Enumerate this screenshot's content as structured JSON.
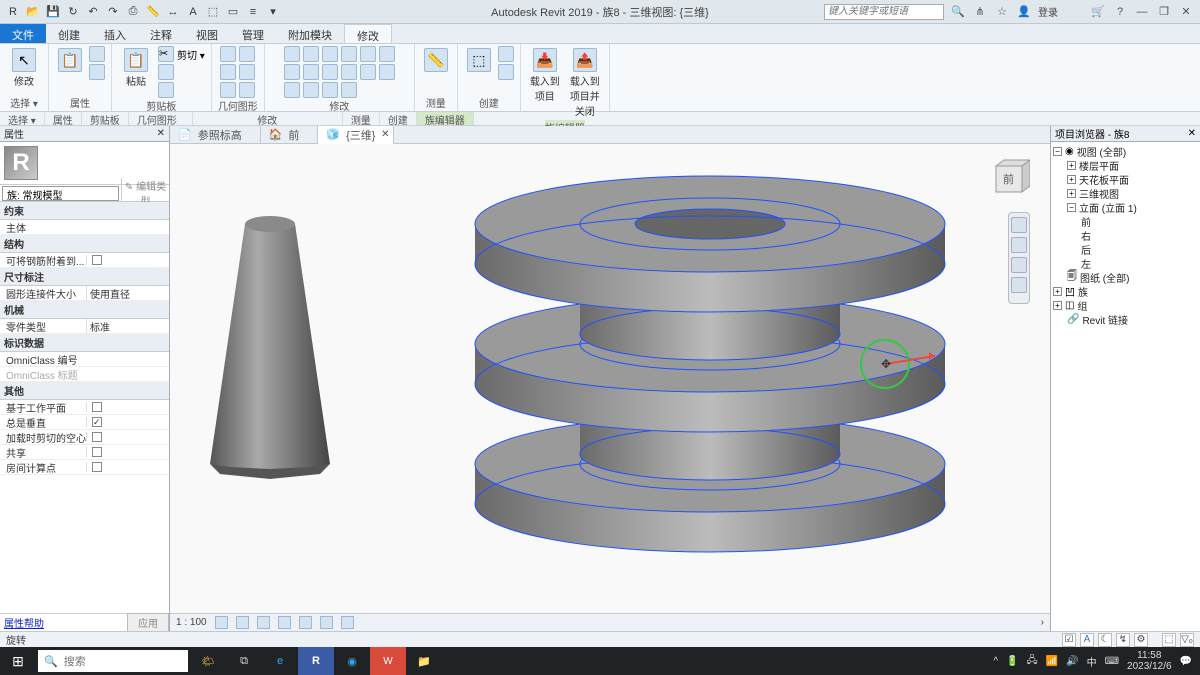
{
  "titlebar": {
    "app": "Autodesk Revit 2019 - 族8 - 三维视图: {三维}",
    "search_placeholder": "键入关键字或短语",
    "login": "登录"
  },
  "ribbon": {
    "tabs": [
      "文件",
      "创建",
      "插入",
      "注释",
      "视图",
      "管理",
      "附加模块",
      "修改"
    ],
    "active": "修改",
    "panels": {
      "select": "选择 ▾",
      "properties": "属性",
      "clipboard": "剪贴板",
      "clipboard_paste": "粘贴",
      "clipboard_cut": "剪切 ▾",
      "geometry": "几何图形",
      "modify": "修改",
      "measure": "测量",
      "create": "创建",
      "loadinto": "载入到\n项目",
      "loadclose": "载入到\n项目并关闭",
      "family_editor": "族编辑器"
    }
  },
  "props": {
    "title": "属性",
    "family_type": "族: 常规模型",
    "edit_type": "编辑类型",
    "groups": {
      "constraints": "约束",
      "host": "主体",
      "structural": "结构",
      "rebar": "可将钢筋附着到...",
      "dimensions": "尺寸标注",
      "round_connector": "圆形连接件大小",
      "round_connector_val": "使用直径",
      "mechanical": "机械",
      "part_type": "零件类型",
      "part_type_val": "标准",
      "identity": "标识数据",
      "omni_num": "OmniClass 编号",
      "omni_title": "OmniClass 标题",
      "other": "其他",
      "workplane": "基于工作平面",
      "always_vert": "总是垂直",
      "void_cut": "加载时剪切的空心",
      "share": "共享",
      "room_calc": "房间计算点"
    },
    "help": "属性帮助",
    "apply": "应用"
  },
  "viewtabs": {
    "t1": "参照标高",
    "t2": "前",
    "t3": "{三维}"
  },
  "browser": {
    "title": "项目浏览器 - 族8",
    "views": "视图 (全部)",
    "floor": "楼层平面",
    "ceiling": "天花板平面",
    "threed": "三维视图",
    "elev": "立面 (立面 1)",
    "front": "前",
    "right": "右",
    "back": "后",
    "left": "左",
    "sheets": "图纸 (全部)",
    "families": "族",
    "groups": "组",
    "links": "Revit 链接"
  },
  "viewstatus": {
    "scale": "1 : 100"
  },
  "appstatus": {
    "mode": "旋转"
  },
  "viewcube": {
    "front": "前"
  },
  "taskbar": {
    "search": "搜索",
    "time": "11:58",
    "date": "2023/12/6"
  }
}
